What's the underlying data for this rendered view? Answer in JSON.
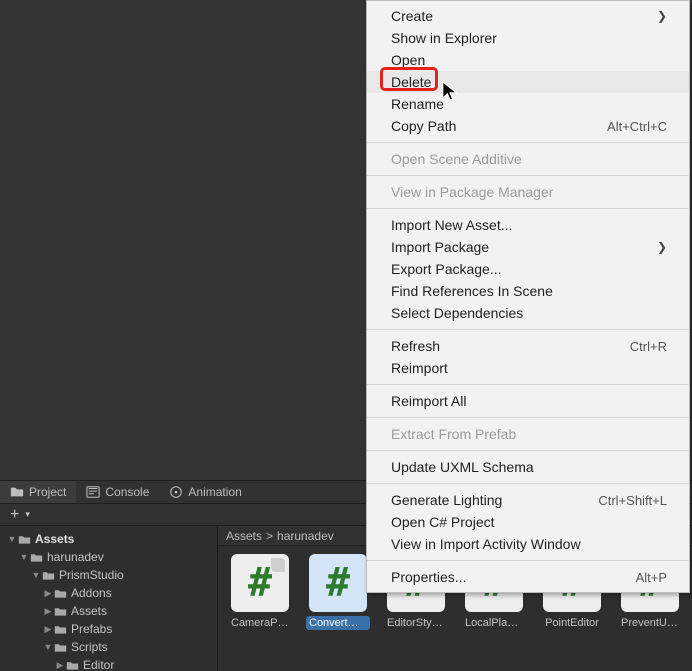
{
  "tabs": {
    "project": "Project",
    "console": "Console",
    "animation": "Animation"
  },
  "plus_label": "+",
  "tree": {
    "assets": "Assets",
    "harunadev": "harunadev",
    "prismstudio": "PrismStudio",
    "addons": "Addons",
    "assets_sub": "Assets",
    "prefabs": "Prefabs",
    "scripts": "Scripts",
    "editor": "Editor"
  },
  "breadcrumb": {
    "p0": "Assets",
    "sep": ">",
    "p1": "harunadev"
  },
  "thumbs": [
    {
      "label": "CameraPr..."
    },
    {
      "label": "ConvertOl..."
    },
    {
      "label": "EditorStyles"
    },
    {
      "label": "LocalPlaye..."
    },
    {
      "label": "PointEditor"
    },
    {
      "label": "PreventUn..."
    }
  ],
  "menu": {
    "create": "Create",
    "show_explorer": "Show in Explorer",
    "open": "Open",
    "delete": "Delete",
    "rename": "Rename",
    "copy_path": "Copy Path",
    "copy_path_sc": "Alt+Ctrl+C",
    "open_scene": "Open Scene Additive",
    "view_pkg": "View in Package Manager",
    "import_asset": "Import New Asset...",
    "import_pkg": "Import Package",
    "export_pkg": "Export Package...",
    "find_refs": "Find References In Scene",
    "select_deps": "Select Dependencies",
    "refresh": "Refresh",
    "refresh_sc": "Ctrl+R",
    "reimport": "Reimport",
    "reimport_all": "Reimport All",
    "extract_prefab": "Extract From Prefab",
    "update_uxml": "Update UXML Schema",
    "gen_light": "Generate Lighting",
    "gen_light_sc": "Ctrl+Shift+L",
    "open_cs": "Open C# Project",
    "view_import": "View in Import Activity Window",
    "properties": "Properties...",
    "properties_sc": "Alt+P"
  }
}
